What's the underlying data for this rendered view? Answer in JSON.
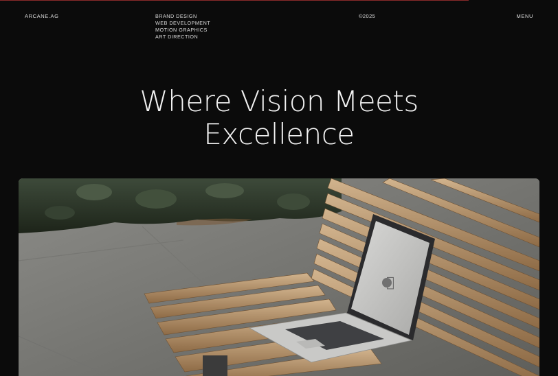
{
  "nav": {
    "brand": "ARCANE.AG",
    "services": [
      "BRAND DESIGN",
      "WEB DEVELOPMENT",
      "MOTION GRAPHICS",
      "ART DIRECTION"
    ],
    "copyright": "©2025",
    "menu_label": "MENU"
  },
  "hero": {
    "title_line1": "Where Vision Meets",
    "title_line2": "Excellence"
  },
  "colors": {
    "background": "#0b0b0b",
    "text": "#f2f2f2",
    "progress_accent": "#8a2a2a"
  },
  "progress": {
    "scroll_fraction": 0.84
  }
}
